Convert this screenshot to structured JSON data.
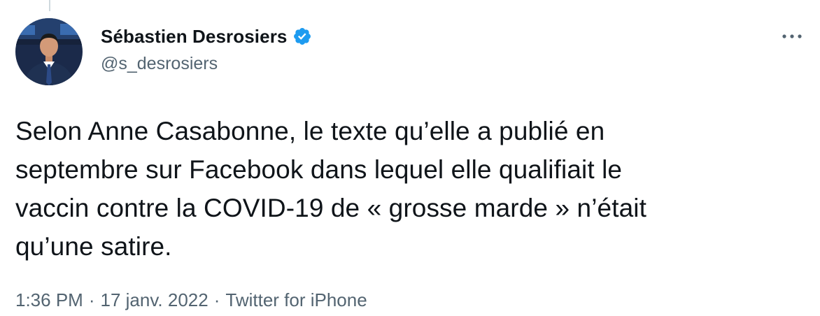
{
  "tweet": {
    "author": {
      "display_name": "Sébastien Desrosiers",
      "handle": "@s_desrosiers",
      "verified": true,
      "avatar_icon": "profile-photo"
    },
    "text": "Selon Anne Casabonne, le texte qu’elle a publié en\nseptembre sur Facebook dans lequel elle qualifiait le\nvaccin contre la COVID-19 de « grosse marde » n’était\nqu’une satire.",
    "time": "1:36 PM",
    "date": "17 janv. 2022",
    "source": "Twitter for iPhone",
    "separator": "·"
  },
  "menu": {
    "icon": "more-horizontal-icon"
  },
  "colors": {
    "verified_blue": "#1d9bf0",
    "text_primary": "#0f1419",
    "text_secondary": "#536471",
    "thread_line": "#cfd9de"
  }
}
